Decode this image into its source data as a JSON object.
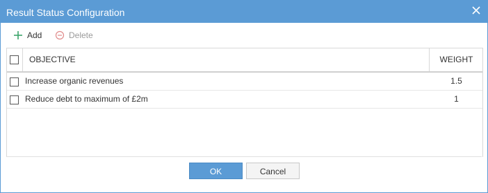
{
  "dialog": {
    "title": "Result Status Configuration",
    "close_icon": "close-icon"
  },
  "toolbar": {
    "add_label": "Add",
    "delete_label": "Delete",
    "add_icon": "plus-icon",
    "delete_icon": "minus-circle-icon"
  },
  "grid": {
    "columns": [
      "OBJECTIVE",
      "WEIGHT"
    ],
    "rows": [
      {
        "objective": "Increase organic revenues",
        "weight": "1.5",
        "checked": false
      },
      {
        "objective": "Reduce debt to maximum of £2m",
        "weight": "1",
        "checked": false
      }
    ]
  },
  "footer": {
    "ok_label": "OK",
    "cancel_label": "Cancel"
  },
  "colors": {
    "accent": "#5b9bd5",
    "delete_icon": "#e08a8a",
    "add_icon": "#3aa36b"
  }
}
